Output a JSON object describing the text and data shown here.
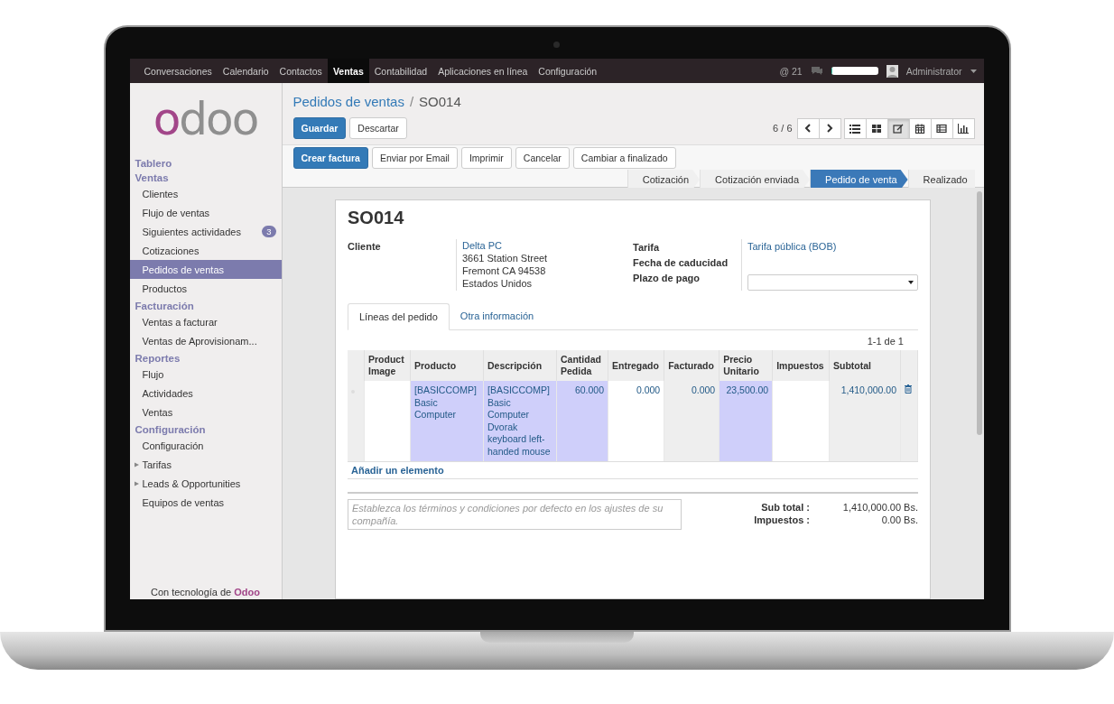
{
  "top_bar": {
    "menus": [
      {
        "label": "Conversaciones",
        "selected": false
      },
      {
        "label": "Calendario",
        "selected": false
      },
      {
        "label": "Contactos",
        "selected": false
      },
      {
        "label": "Ventas",
        "selected": true
      },
      {
        "label": "Contabilidad",
        "selected": false
      },
      {
        "label": "Aplicaciones en línea",
        "selected": false
      },
      {
        "label": "Configuración",
        "selected": false
      }
    ],
    "mentions": "@ 21",
    "progress": {
      "level": 0.03
    },
    "user": "Administrator"
  },
  "sidebar": {
    "logo": "odoo",
    "sections": [
      {
        "title": "Tablero"
      },
      {
        "title": "Ventas",
        "items": [
          {
            "label": "Clientes",
            "selected": false
          },
          {
            "label": "Flujo de ventas",
            "selected": false
          },
          {
            "label": "Siguientes actividades",
            "selected": false,
            "badge": "3"
          },
          {
            "label": "Cotizaciones",
            "selected": false
          },
          {
            "label": "Pedidos de ventas",
            "selected": true
          },
          {
            "label": "Productos",
            "selected": false
          }
        ]
      },
      {
        "title": "Facturación",
        "items": [
          {
            "label": "Ventas a facturar",
            "selected": false
          },
          {
            "label": "Ventas de Aprovisionam...",
            "selected": false
          }
        ]
      },
      {
        "title": "Reportes",
        "items": [
          {
            "label": "Flujo",
            "selected": false
          },
          {
            "label": "Actividades",
            "selected": false
          },
          {
            "label": "Ventas",
            "selected": false
          }
        ]
      },
      {
        "title": "Configuración",
        "items": [
          {
            "label": "Configuración",
            "selected": false
          },
          {
            "label": "Tarifas",
            "selected": false,
            "expanded": false
          },
          {
            "label": "Leads & Opportunities",
            "selected": false,
            "expanded": false
          },
          {
            "label": "Equipos de ventas",
            "selected": false
          }
        ]
      }
    ],
    "footer": "Con tecnología de **Odoo**"
  },
  "breadcrumb": {
    "items": [
      "Pedidos de ventas",
      "SO014"
    ],
    "separator": "/"
  },
  "edit_buttons": [
    {
      "label": "Guardar",
      "primary": true
    },
    {
      "label": "Descartar",
      "primary": false
    }
  ],
  "pager": "6 / 6",
  "views": [
    {
      "kind": "list",
      "selected": false
    },
    {
      "kind": "kanban",
      "selected": false
    },
    {
      "kind": "form",
      "selected": true
    },
    {
      "kind": "calendar",
      "selected": false
    },
    {
      "kind": "pivot",
      "selected": false
    },
    {
      "kind": "graph",
      "selected": false
    }
  ],
  "action_buttons": [
    {
      "label": "Crear factura",
      "primary": true
    },
    {
      "label": "Enviar por Email",
      "primary": false
    },
    {
      "label": "Imprimir",
      "primary": false
    },
    {
      "label": "Cancelar",
      "primary": false
    },
    {
      "label": "Cambiar a finalizado",
      "primary": false
    }
  ],
  "stages": [
    {
      "label": "Cotización",
      "selected": false
    },
    {
      "label": "Cotización enviada",
      "selected": false
    },
    {
      "label": "Pedido de venta",
      "selected": true
    },
    {
      "label": "Realizado",
      "selected": false
    }
  ],
  "sheet": {
    "title": "SO014",
    "customer": {
      "label": "Cliente",
      "name": "Delta PC",
      "address": [
        "3661 Station Street",
        "Fremont CA 94538",
        "Estados Unidos"
      ]
    },
    "right_fields": [
      {
        "label": "Tarifa",
        "kind": "link",
        "value": "Tarifa pública (BOB)"
      },
      {
        "label": "Fecha de caducidad",
        "kind": "empty"
      },
      {
        "label": "Plazo de pago",
        "kind": "select"
      }
    ],
    "tabs": [
      {
        "label": "Líneas del pedido",
        "selected": true
      },
      {
        "label": "Otra información",
        "selected": false
      }
    ],
    "lines_pager": "1-1 de 1",
    "table": {
      "columns": [
        {
          "label": "Product Image",
          "highlighted": false
        },
        {
          "label": "Producto",
          "highlighted": true
        },
        {
          "label": "Descripción",
          "highlighted": true
        },
        {
          "label": "Cantidad Pedida",
          "highlighted": true
        },
        {
          "label": "Entregado",
          "highlighted": false
        },
        {
          "label": "Facturado",
          "highlighted": false
        },
        {
          "label": "Precio Unitario",
          "highlighted": true
        },
        {
          "label": "Impuestos",
          "highlighted": false
        },
        {
          "label": "Subtotal",
          "highlighted": false
        }
      ],
      "rows": [
        [
          "",
          "[BASICCOMP] Basic Computer",
          "[BASICCOMP] Basic Computer Dvorak keyboard left-handed mouse",
          "60.000",
          "0.000",
          "0.000",
          "23,500.00",
          "",
          "1,410,000.00"
        ]
      ]
    },
    "add_line": "Añadir un elemento",
    "terms": {
      "placeholder": "Establezca los términos y condiciones por defecto en los ajustes de su compañía."
    },
    "totals": [
      {
        "label": "Sub total :",
        "value": "1,410,000.00 Bs."
      },
      {
        "label": "Impuestos :",
        "value": "0.00 Bs."
      }
    ]
  }
}
